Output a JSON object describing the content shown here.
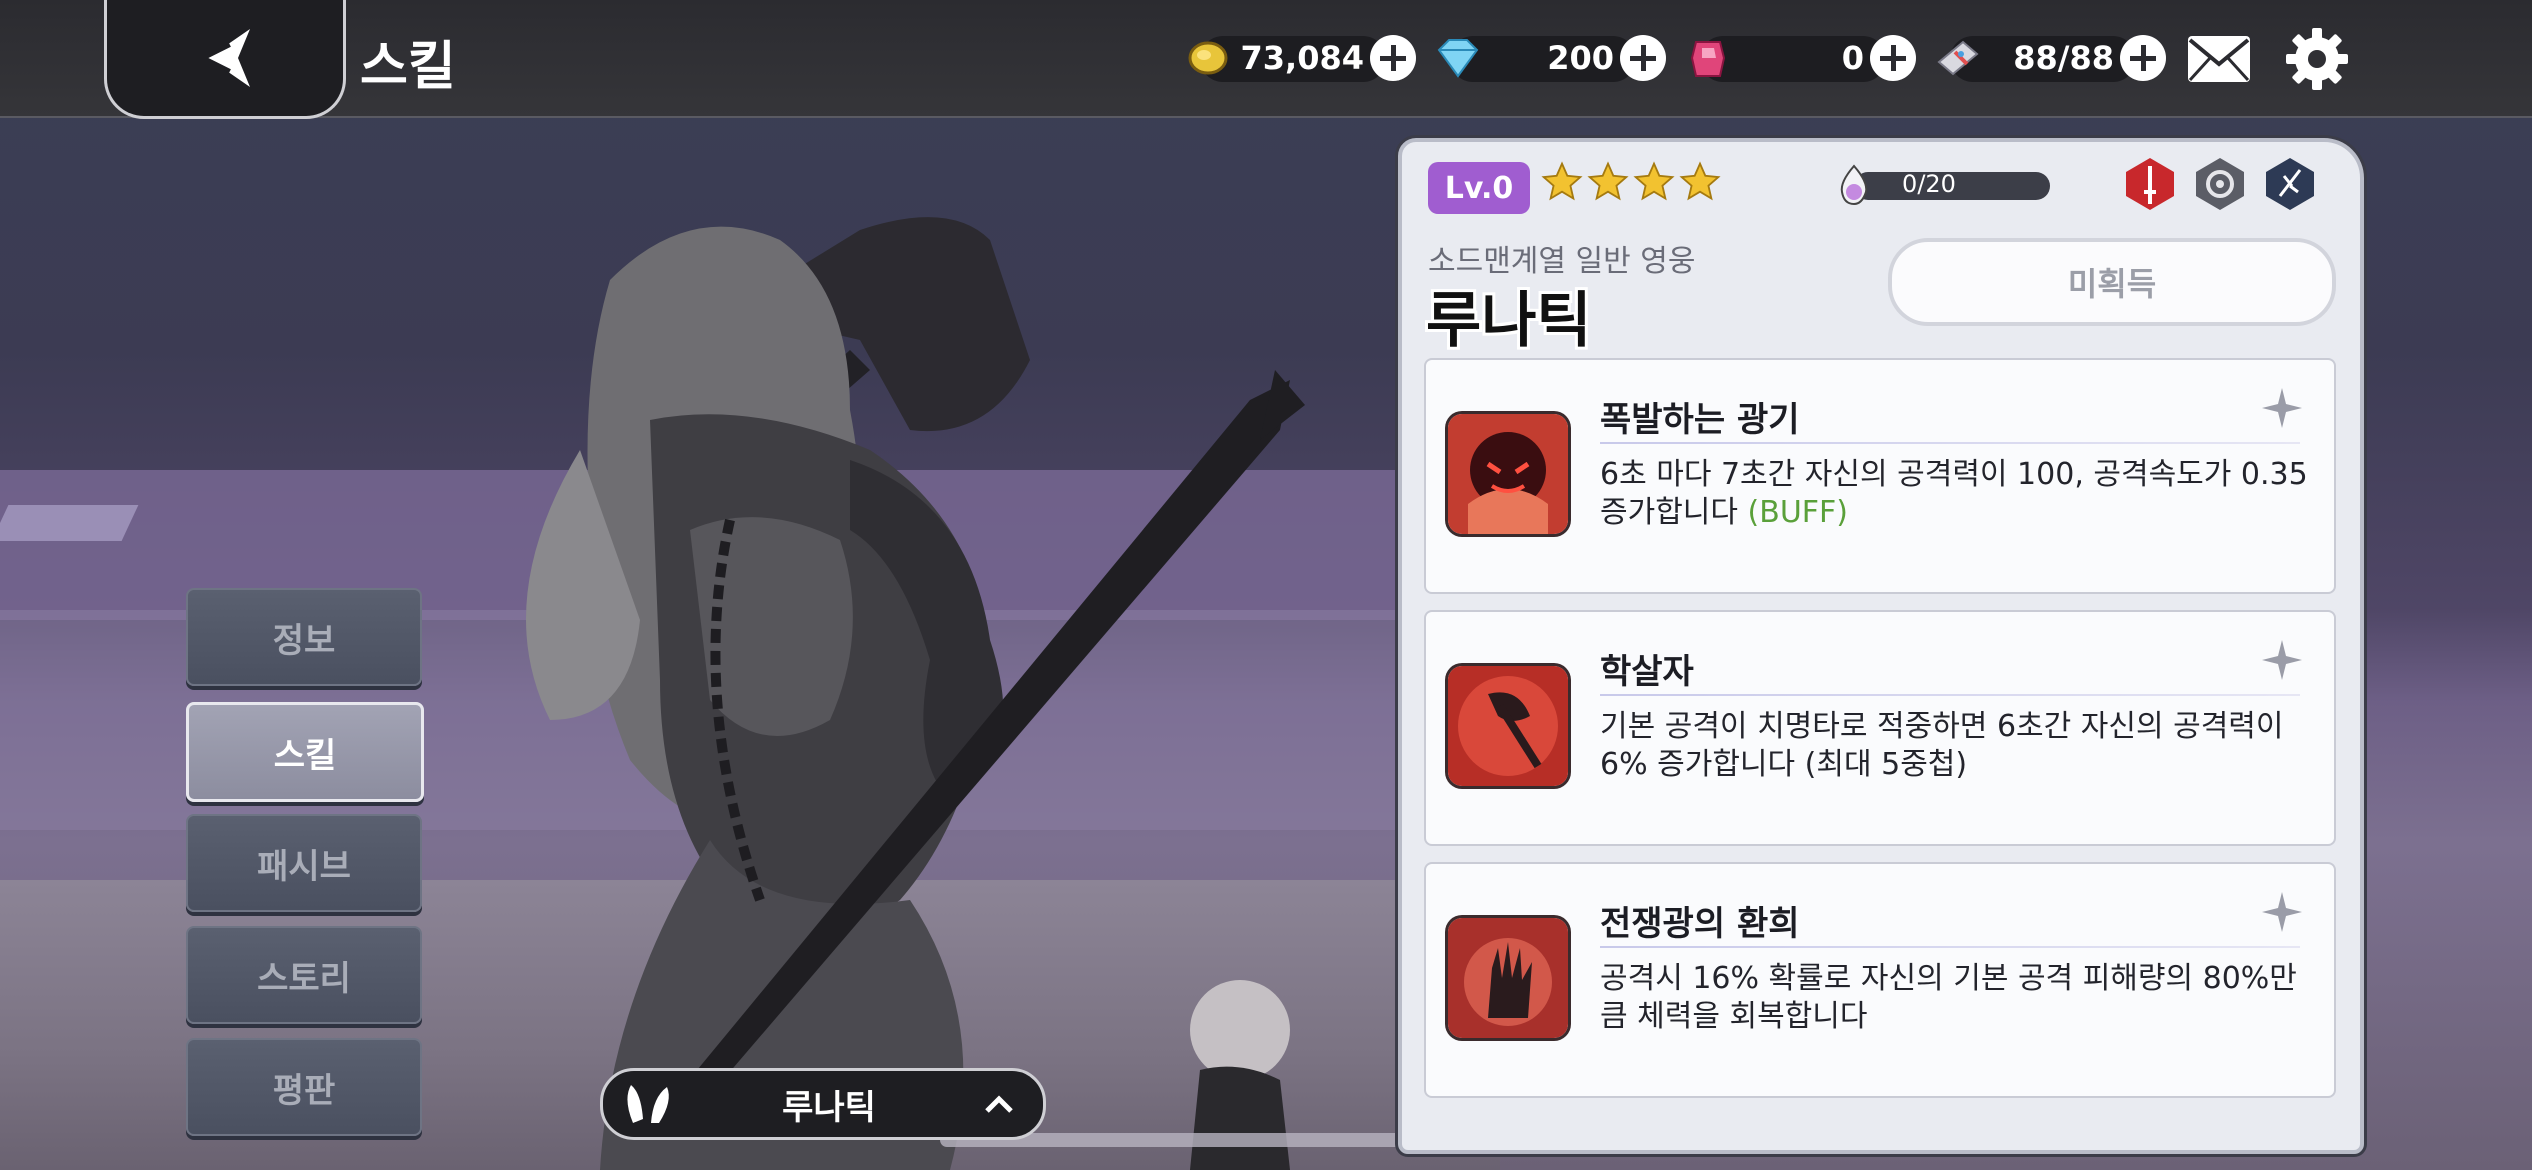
{
  "header": {
    "title": "스킬",
    "currencies": [
      {
        "icon": "gold-coin-icon",
        "value": "73,084"
      },
      {
        "icon": "diamond-icon",
        "value": "200"
      },
      {
        "icon": "ruby-gem-icon",
        "value": "0"
      },
      {
        "icon": "stamina-ticket-icon",
        "value": "88/88"
      }
    ]
  },
  "menu": {
    "items": [
      {
        "label": "정보"
      },
      {
        "label": "스킬",
        "active": true
      },
      {
        "label": "패시브"
      },
      {
        "label": "스토리"
      },
      {
        "label": "평판"
      }
    ]
  },
  "selector": {
    "hero_name": "루나틱"
  },
  "hero": {
    "level": "Lv.0",
    "stars": 4,
    "soul_progress": "0/20",
    "class_line": "소드맨계열 일반 영웅",
    "name": "루나틱",
    "status_button": "미획득"
  },
  "skills": [
    {
      "name": "폭발하는 광기",
      "desc": "6초 마다 7초간 자신의 공격력이 100, 공격속도가 0.35 증가합니다",
      "tag": "(BUFF)"
    },
    {
      "name": "학살자",
      "desc": "기본 공격이 치명타로 적중하면 6초간 자신의 공격력이 6% 증가합니다 (최대 5중첩)",
      "tag": ""
    },
    {
      "name": "전쟁광의 환희",
      "desc": "공격시 16% 확률로 자신의 기본 공격 피해량의 80%만큼 체력을 회복합니다",
      "tag": ""
    }
  ],
  "colors": {
    "accent_purple": "#a05dd0",
    "buff_green": "#5aa03a",
    "star": "#f2c230"
  }
}
